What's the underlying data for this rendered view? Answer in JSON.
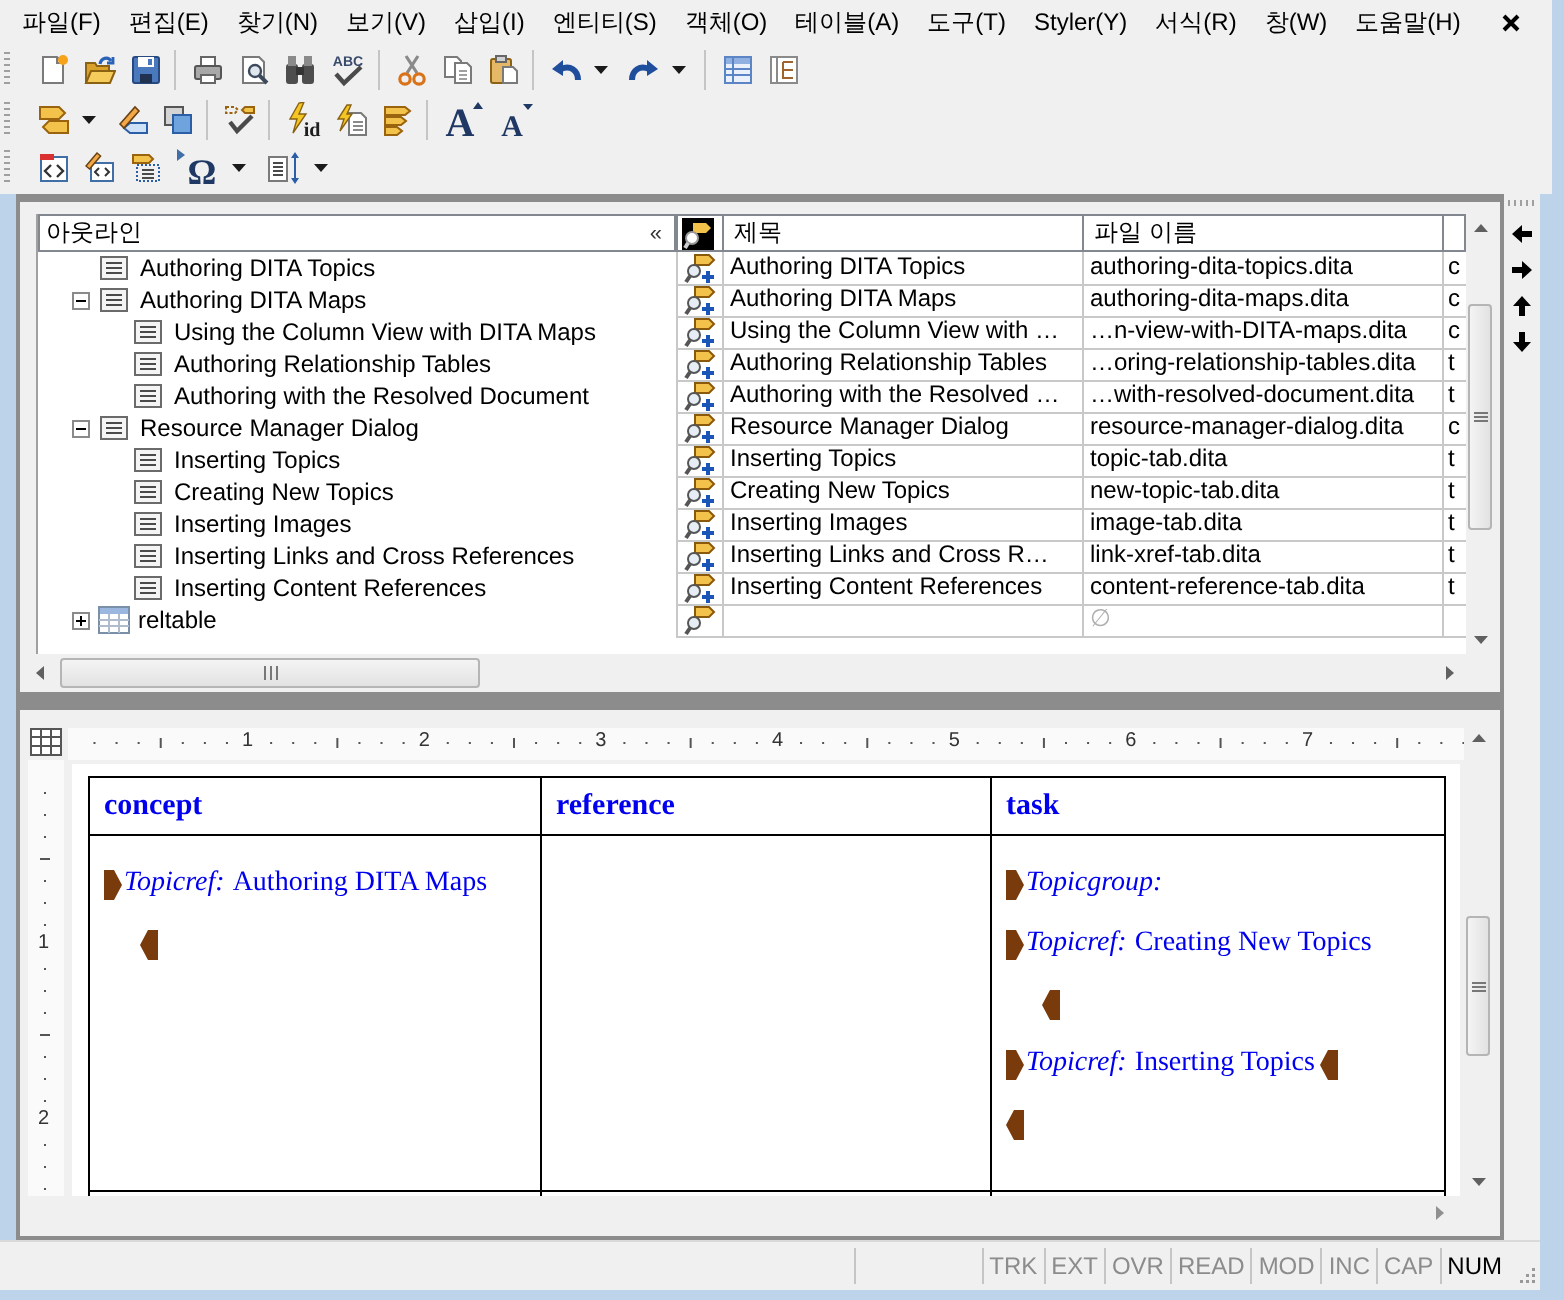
{
  "menu_bar": {
    "items": [
      "파일(F)",
      "편집(E)",
      "찾기(N)",
      "보기(V)",
      "삽입(I)",
      "엔티티(S)",
      "객체(O)",
      "테이블(A)",
      "도구(T)",
      "Styler(Y)",
      "서식(R)",
      "창(W)",
      "도움말(H)"
    ]
  },
  "toolbars": [
    [
      {
        "kind": "new"
      },
      {
        "kind": "open"
      },
      {
        "kind": "save"
      },
      {
        "kind": "separator"
      },
      {
        "kind": "print"
      },
      {
        "kind": "preview"
      },
      {
        "kind": "find"
      },
      {
        "kind": "spell",
        "glyph": "ABC"
      },
      {
        "kind": "separator"
      },
      {
        "kind": "cut"
      },
      {
        "kind": "copy"
      },
      {
        "kind": "paste"
      },
      {
        "kind": "separator"
      },
      {
        "kind": "undo"
      },
      {
        "kind": "caret"
      },
      {
        "kind": "redo"
      },
      {
        "kind": "caret"
      },
      {
        "kind": "separator"
      },
      {
        "kind": "table_view"
      },
      {
        "kind": "tree_view"
      }
    ],
    [
      {
        "kind": "tags"
      },
      {
        "kind": "caret"
      },
      {
        "kind": "edit_tag"
      },
      {
        "kind": "overlap"
      },
      {
        "kind": "separator"
      },
      {
        "kind": "tag_check"
      },
      {
        "kind": "separator"
      },
      {
        "kind": "lightning_id",
        "glyph": "id"
      },
      {
        "kind": "lightning_doc"
      },
      {
        "kind": "tag_list"
      },
      {
        "kind": "separator"
      },
      {
        "kind": "font_grow",
        "glyph": "A"
      },
      {
        "kind": "font_shrink",
        "glyph": "A"
      }
    ],
    [
      {
        "kind": "code_doc"
      },
      {
        "kind": "pencil_code"
      },
      {
        "kind": "tag_box"
      },
      {
        "kind": "special_char",
        "glyph": "Ω"
      },
      {
        "kind": "caret"
      },
      {
        "kind": "line_spacing"
      },
      {
        "kind": "caret"
      }
    ]
  ],
  "outline": {
    "title": "아웃라인",
    "collapse": "«",
    "items": [
      {
        "label": "Authoring DITA Topics",
        "kind": "topic"
      },
      {
        "label": "Authoring DITA Maps",
        "kind": "topic",
        "expanded": true,
        "children": [
          {
            "label": "Using the Column View with DITA Maps",
            "kind": "topic"
          },
          {
            "label": "Authoring Relationship Tables",
            "kind": "topic"
          },
          {
            "label": "Authoring with the Resolved Document",
            "kind": "topic"
          }
        ]
      },
      {
        "label": "Resource Manager Dialog",
        "kind": "topic",
        "expanded": true,
        "children": [
          {
            "label": "Inserting Topics",
            "kind": "topic"
          },
          {
            "label": "Creating New Topics",
            "kind": "topic"
          },
          {
            "label": "Inserting Images",
            "kind": "topic"
          },
          {
            "label": "Inserting Links and Cross References",
            "kind": "topic"
          },
          {
            "label": "Inserting Content References",
            "kind": "topic"
          }
        ]
      },
      {
        "label": "reltable",
        "kind": "reltable",
        "expanded": false
      }
    ]
  },
  "resource_table": {
    "columns": [
      "제목",
      "파일 이름"
    ],
    "rows": [
      {
        "title": "Authoring DITA Topics",
        "file": "authoring-dita-topics.dita",
        "column_3": "c"
      },
      {
        "title": "Authoring DITA Maps",
        "file": "authoring-dita-maps.dita",
        "column_3": "c"
      },
      {
        "title": "Using the Column View with …",
        "file": "…n-view-with-DITA-maps.dita",
        "column_3": "c"
      },
      {
        "title": "Authoring Relationship Tables",
        "file": "…oring-relationship-tables.dita",
        "column_3": "t"
      },
      {
        "title": "Authoring with the Resolved …",
        "file": "…with-resolved-document.dita",
        "column_3": "t"
      },
      {
        "title": "Resource Manager Dialog",
        "file": "resource-manager-dialog.dita",
        "column_3": "c"
      },
      {
        "title": "Inserting Topics",
        "file": "topic-tab.dita",
        "column_3": "t"
      },
      {
        "title": "Creating New Topics",
        "file": "new-topic-tab.dita",
        "column_3": "t"
      },
      {
        "title": "Inserting Images",
        "file": "image-tab.dita",
        "column_3": "t"
      },
      {
        "title": "Inserting Links and Cross R…",
        "file": "link-xref-tab.dita",
        "column_3": "t"
      },
      {
        "title": "Inserting Content References",
        "file": "content-reference-tab.dita",
        "column_3": "t"
      }
    ],
    "new_row": {
      "file": "∅"
    }
  },
  "editor": {
    "ruler": {
      "horizontal": [
        "1",
        "2",
        "3",
        "4",
        "5",
        "6",
        "7"
      ],
      "vertical": [
        "1",
        "2"
      ]
    },
    "table": {
      "columns": [
        "concept",
        "reference",
        "task"
      ],
      "cells": [
        {
          "lines": [
            {
              "tokens": [
                {
                  "kind": "start"
                },
                {
                  "kind": "element",
                  "text": "Topicref:"
                },
                {
                  "kind": "text",
                  "text": "Authoring DITA Maps"
                }
              ],
              "children": [
                {
                  "tokens": [
                    {
                      "kind": "end"
                    }
                  ]
                }
              ]
            }
          ]
        },
        {},
        {
          "lines": [
            {
              "tokens": [
                {
                  "kind": "start"
                },
                {
                  "kind": "element",
                  "text": "Topicgroup:"
                }
              ]
            },
            {
              "tokens": [
                {
                  "kind": "start"
                },
                {
                  "kind": "element",
                  "text": "Topicref:"
                },
                {
                  "kind": "text",
                  "text": "Creating New Topics"
                }
              ],
              "children": [
                {
                  "tokens": [
                    {
                      "kind": "end"
                    }
                  ]
                }
              ]
            },
            {
              "tokens": [
                {
                  "kind": "start"
                },
                {
                  "kind": "element",
                  "text": "Topicref:"
                },
                {
                  "kind": "text",
                  "text": "Inserting Topics"
                },
                {
                  "kind": "end"
                }
              ]
            },
            {
              "tokens": [
                {
                  "kind": "end"
                }
              ]
            }
          ]
        }
      ]
    }
  },
  "status_bar": {
    "indicators": [
      {
        "label": "TRK",
        "on": false
      },
      {
        "label": "EXT",
        "on": false
      },
      {
        "label": "OVR",
        "on": false
      },
      {
        "label": "READ",
        "on": false
      },
      {
        "label": "MOD",
        "on": false
      },
      {
        "label": "INC",
        "on": false
      },
      {
        "label": "CAP",
        "on": false
      },
      {
        "label": "NUM",
        "on": true
      }
    ]
  }
}
